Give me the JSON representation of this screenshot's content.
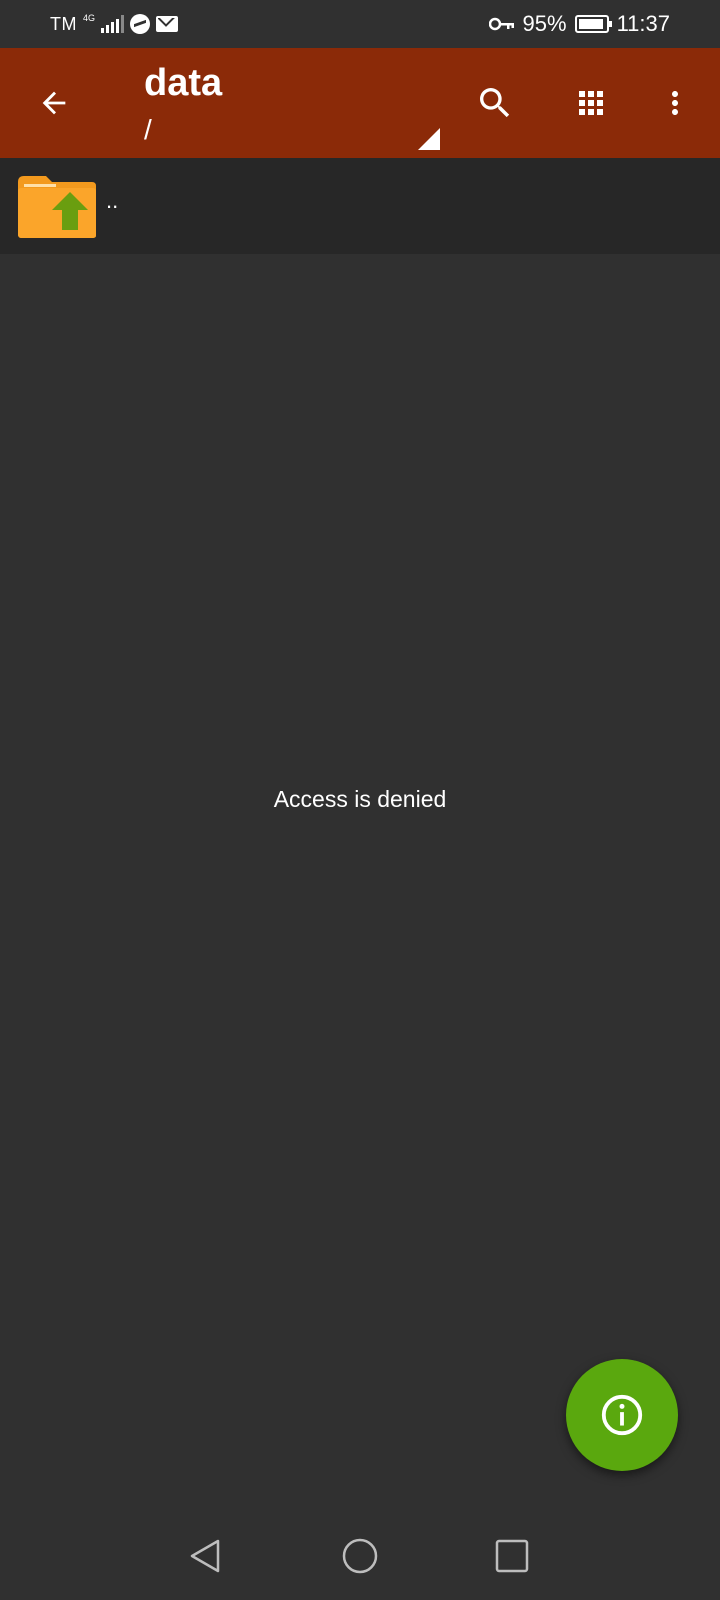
{
  "status_bar": {
    "carrier": "TM",
    "network_type": "4G",
    "battery_percent": "95%",
    "battery_level": 0.95,
    "time": "11:37",
    "icons": [
      "signal-icon",
      "messenger-icon",
      "mail-icon",
      "vpn-key-icon",
      "battery-icon"
    ]
  },
  "app_bar": {
    "title": "data",
    "path": "/",
    "actions": [
      "search-icon",
      "grid-view-icon",
      "more-options-icon"
    ],
    "color": "#8b2a08"
  },
  "list": {
    "items": [
      {
        "label": "..",
        "icon": "parent-folder-icon"
      }
    ]
  },
  "main": {
    "message": "Access is denied"
  },
  "fab": {
    "icon": "info-icon",
    "color": "#5aa80e"
  },
  "nav_bar": {
    "buttons": [
      "nav-back-icon",
      "nav-home-icon",
      "nav-recents-icon"
    ]
  }
}
